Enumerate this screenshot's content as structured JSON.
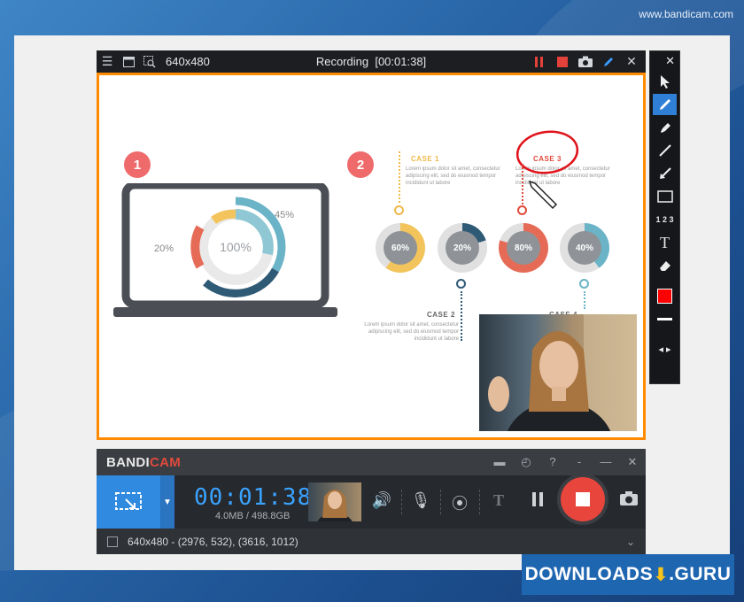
{
  "site_watermark": "www.bandicam.com",
  "recording_bar": {
    "resolution": "640x480",
    "status": "Recording",
    "elapsed": "[00:01:38]"
  },
  "slide": {
    "step1": "1",
    "step2": "2",
    "laptop_center": "100%",
    "label_45": "45%",
    "label_20": "20%",
    "cases": [
      "CASE 1",
      "CASE 2",
      "CASE 3",
      "CASE 4"
    ],
    "lorem": "Lorem ipsum dolor sit amet, consectetur adipiscing elit, sed do eiusmod tempor incididunt ut labore",
    "rings": [
      "60%",
      "20%",
      "80%",
      "40%"
    ]
  },
  "tools": {
    "items": [
      "select-tool",
      "pen-tool",
      "highlighter-tool",
      "line-tool",
      "arrow-tool",
      "rectangle-tool",
      "numbering-tool",
      "text-tool",
      "eraser-tool",
      "color-swatch",
      "line-width",
      "toggle-position"
    ],
    "text_tool_glyph": "T",
    "numbering_glyph": "1 2 3",
    "active_color": "#ff0000"
  },
  "bandicam": {
    "brand_main": "BANDI",
    "brand_cam": "CAM",
    "timer": "00:01:38",
    "size": "4.0MB / 498.8GB",
    "region": "640x480 - (2976, 532), (3616, 1012)"
  },
  "downloads_guru": {
    "left": "DOWNLOADS",
    "right": ".GURU"
  },
  "colors": {
    "accent": "#2f8ae0",
    "record_frame": "#ff8a00",
    "stop": "#e8453c",
    "step_circle": "#ef6b6b"
  }
}
